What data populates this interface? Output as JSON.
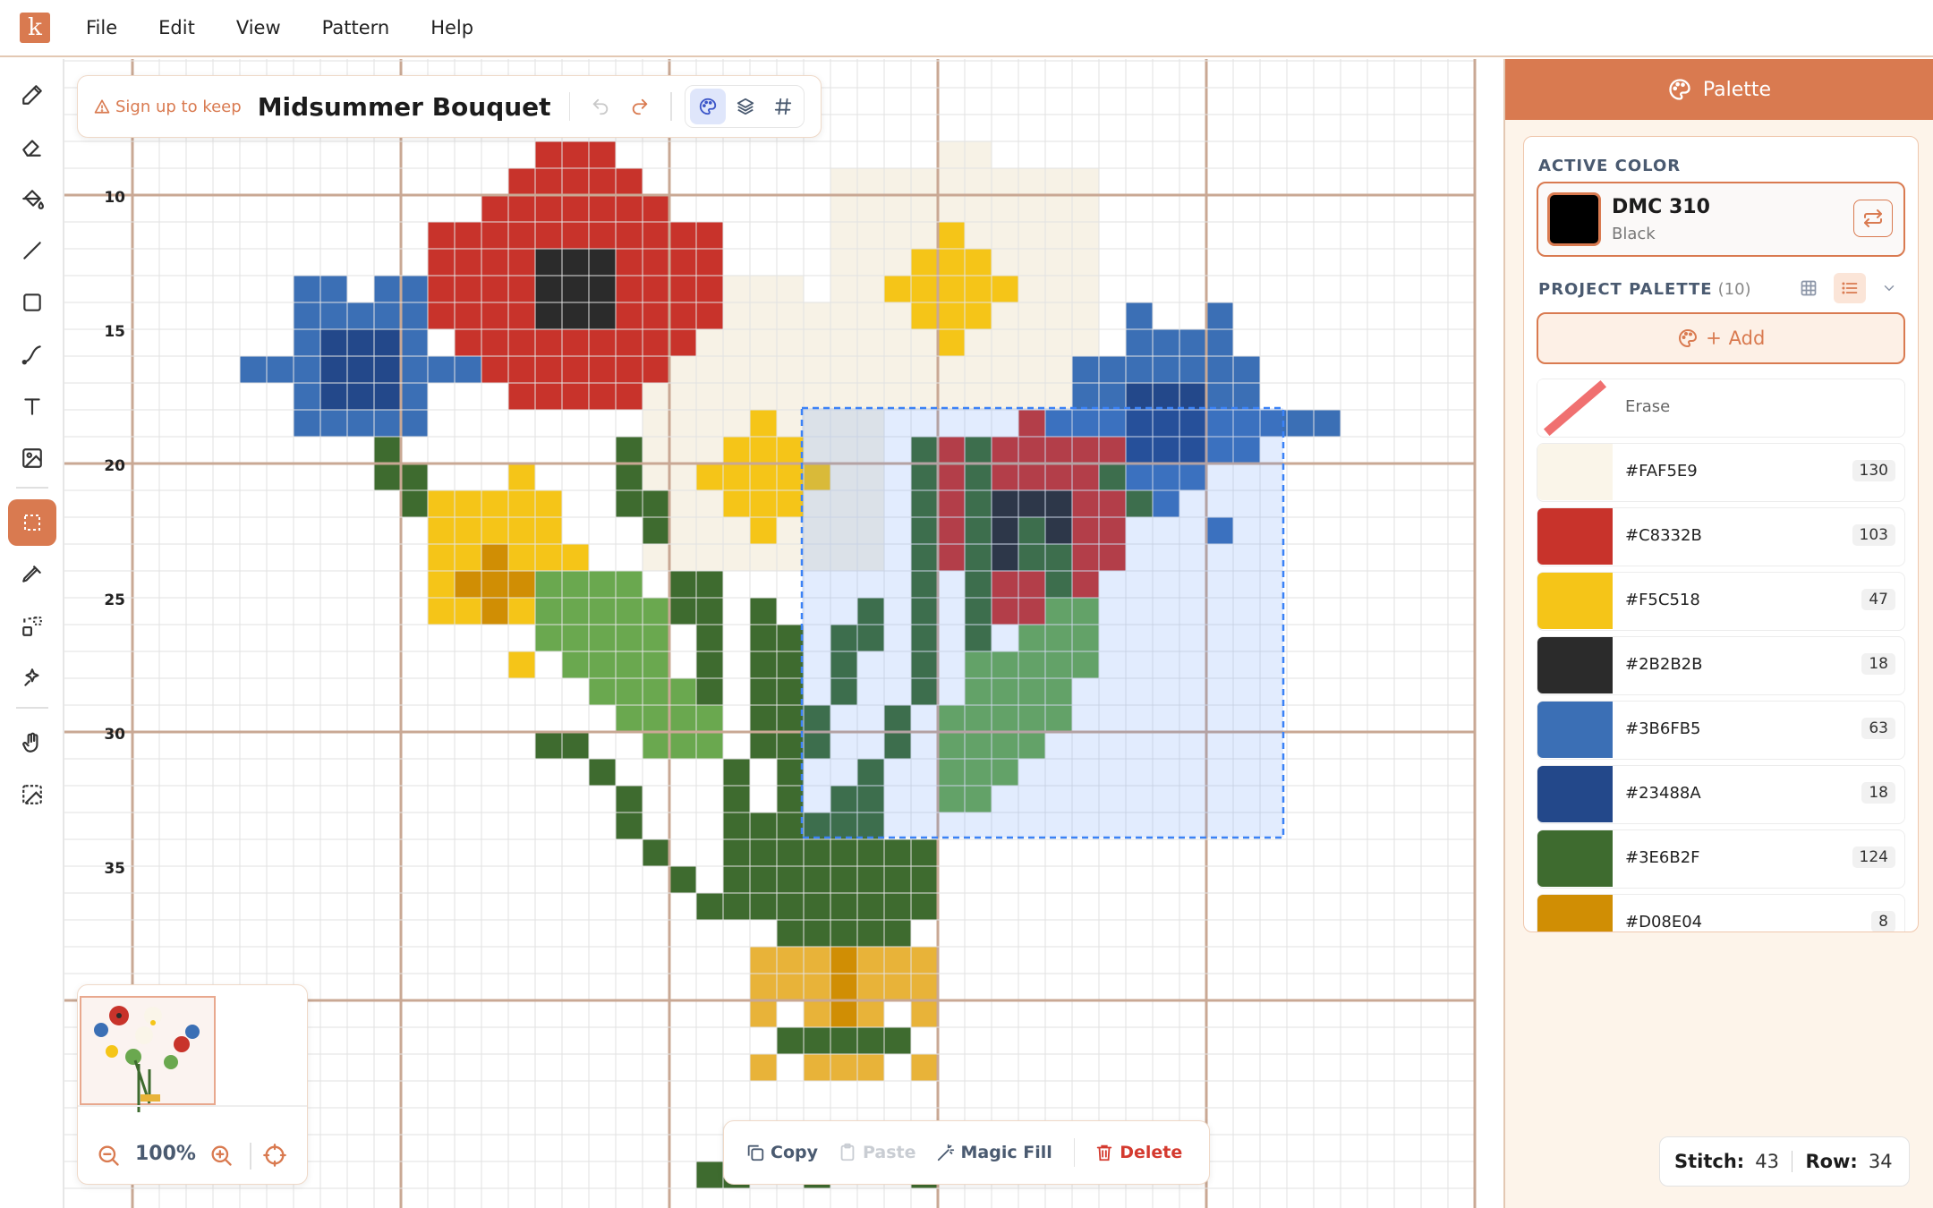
{
  "app": {
    "logo_letter": "k",
    "menu": [
      "File",
      "Edit",
      "View",
      "Pattern",
      "Help"
    ]
  },
  "toolbar": {
    "tools": [
      "pencil",
      "eraser",
      "fill-bucket",
      "line",
      "rectangle",
      "backstitch",
      "text",
      "image",
      "select",
      "eyedropper",
      "replace-color",
      "magic-wand",
      "hand",
      "image-trace"
    ],
    "active_tool": "select"
  },
  "title_card": {
    "signup_label": "Sign up to keep",
    "project_title": "Midsummer Bouquet"
  },
  "canvas": {
    "row_numbers": [
      "10",
      "15",
      "20",
      "25",
      "30",
      "35"
    ]
  },
  "palette_panel": {
    "header": "Palette",
    "active_label": "ACTIVE COLOR",
    "active_name": "DMC 310",
    "active_sub": "Black",
    "active_color": "#000000",
    "project_label": "PROJECT PALETTE",
    "project_count": "(10)",
    "add_label": "Add",
    "erase_label": "Erase",
    "swatches": [
      {
        "hex": "#FAF5E9",
        "count": "130"
      },
      {
        "hex": "#C8332B",
        "count": "103"
      },
      {
        "hex": "#F5C518",
        "count": "47"
      },
      {
        "hex": "#2B2B2B",
        "count": "18"
      },
      {
        "hex": "#3B6FB5",
        "count": "63"
      },
      {
        "hex": "#23488A",
        "count": "18"
      },
      {
        "hex": "#3E6B2F",
        "count": "124"
      },
      {
        "hex": "#D08E04",
        "count": "8"
      }
    ]
  },
  "minimap": {
    "zoom": "100%"
  },
  "selection_bar": {
    "copy": "Copy",
    "paste": "Paste",
    "magic_fill": "Magic Fill",
    "delete": "Delete"
  },
  "status": {
    "stitch_label": "Stitch:",
    "stitch_value": "43",
    "row_label": "Row:",
    "row_value": "34"
  },
  "colors": {
    "accent": "#d97a50",
    "selection": "#3b82f6"
  }
}
